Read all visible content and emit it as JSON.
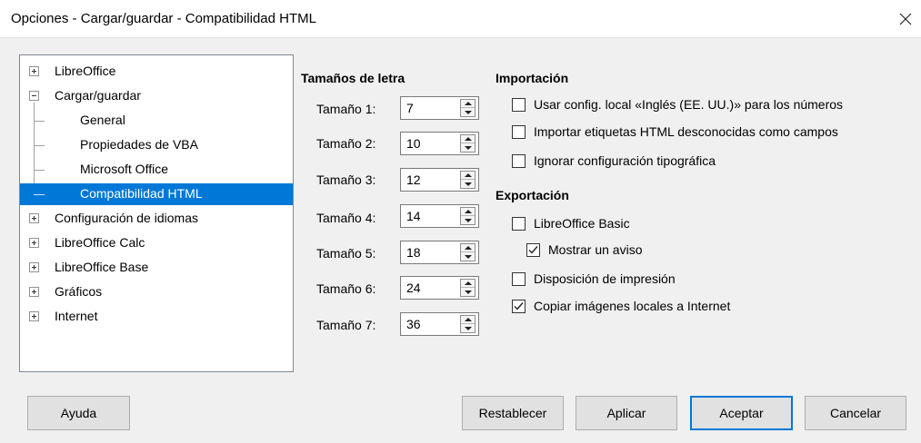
{
  "window": {
    "title": "Opciones - Cargar/guardar - Compatibilidad HTML",
    "close_icon": "close-icon"
  },
  "tree": {
    "items": [
      {
        "label": "LibreOffice",
        "expander": "plus",
        "level": 0
      },
      {
        "label": "Cargar/guardar",
        "expander": "minus",
        "level": 0
      },
      {
        "label": "General",
        "level": 1
      },
      {
        "label": "Propiedades de VBA",
        "level": 1
      },
      {
        "label": "Microsoft Office",
        "level": 1
      },
      {
        "label": "Compatibilidad HTML",
        "level": 1,
        "selected": true
      },
      {
        "label": "Configuración de idiomas",
        "expander": "plus",
        "level": 0
      },
      {
        "label": "LibreOffice Calc",
        "expander": "plus",
        "level": 0
      },
      {
        "label": "LibreOffice Base",
        "expander": "plus",
        "level": 0
      },
      {
        "label": "Gráficos",
        "expander": "plus",
        "level": 0
      },
      {
        "label": "Internet",
        "expander": "plus",
        "level": 0
      }
    ]
  },
  "font_sizes": {
    "title": "Tamaños de letra",
    "rows": [
      {
        "label": "Tamaño 1:",
        "value": "7"
      },
      {
        "label": "Tamaño 2:",
        "value": "10"
      },
      {
        "label": "Tamaño 3:",
        "value": "12"
      },
      {
        "label": "Tamaño 4:",
        "value": "14"
      },
      {
        "label": "Tamaño 5:",
        "value": "18"
      },
      {
        "label": "Tamaño 6:",
        "value": "24"
      },
      {
        "label": "Tamaño 7:",
        "value": "36"
      }
    ]
  },
  "import": {
    "title": "Importación",
    "options": [
      {
        "label": "Usar config. local «Inglés (EE. UU.)» para los números",
        "checked": false
      },
      {
        "label": "Importar etiquetas HTML desconocidas como campos",
        "checked": false
      },
      {
        "label": "Ignorar configuración tipográfica",
        "checked": false
      }
    ]
  },
  "export": {
    "title": "Exportación",
    "options": [
      {
        "label": "LibreOffice Basic",
        "checked": false
      },
      {
        "label": "Mostrar un aviso",
        "checked": true
      },
      {
        "label": "Disposición de impresión",
        "checked": false
      },
      {
        "label": "Copiar imágenes locales a Internet",
        "checked": true
      }
    ]
  },
  "buttons": {
    "help": "Ayuda",
    "reset": "Restablecer",
    "apply": "Aplicar",
    "ok": "Aceptar",
    "cancel": "Cancelar"
  },
  "colors": {
    "selection": "#0078d7",
    "default_button_border": "#0078d7",
    "dialog_background": "#f0f0f0"
  }
}
